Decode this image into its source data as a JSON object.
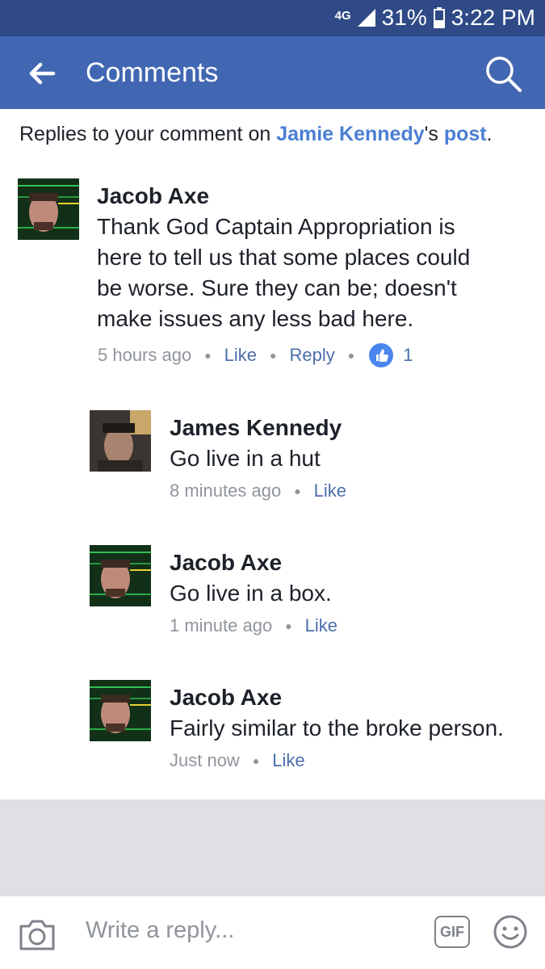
{
  "status_bar": {
    "network": "4G",
    "battery": "31%",
    "time": "3:22 PM"
  },
  "header": {
    "title": "Comments"
  },
  "notice": {
    "prefix": "Replies to your comment on ",
    "person": "Jamie Kennedy",
    "possessive": "'s ",
    "post": "post",
    "suffix": "."
  },
  "comments": [
    {
      "author": "Jacob Axe",
      "lines": [
        "Thank God Captain Appropriation is",
        "here to tell us that some places could",
        "be worse. Sure they can be; doesn't",
        "make issues any less bad here."
      ],
      "time": "5 hours ago",
      "like": "Like",
      "reply": "Reply",
      "reactions": "1"
    },
    {
      "author": "James Kennedy",
      "lines": [
        "Go live in a hut"
      ],
      "time": "8 minutes ago",
      "like": "Like"
    },
    {
      "author": "Jacob Axe",
      "lines": [
        "Go live in a box."
      ],
      "time": "1 minute ago",
      "like": "Like"
    },
    {
      "author": "Jacob Axe",
      "lines": [
        "Fairly similar to the broke person."
      ],
      "time": "Just now",
      "like": "Like"
    }
  ],
  "composer": {
    "placeholder": "Write a reply...",
    "gif_label": "GIF"
  },
  "icons": {
    "back": "arrow-left-icon",
    "search": "search-icon",
    "camera": "camera-icon",
    "emoji": "emoji-icon",
    "like": "thumbs-up-icon"
  },
  "colors": {
    "header": "#4267b2",
    "statusbar": "#2f4a86",
    "link": "#4b7fd4",
    "like_badge": "#4b86ee"
  }
}
